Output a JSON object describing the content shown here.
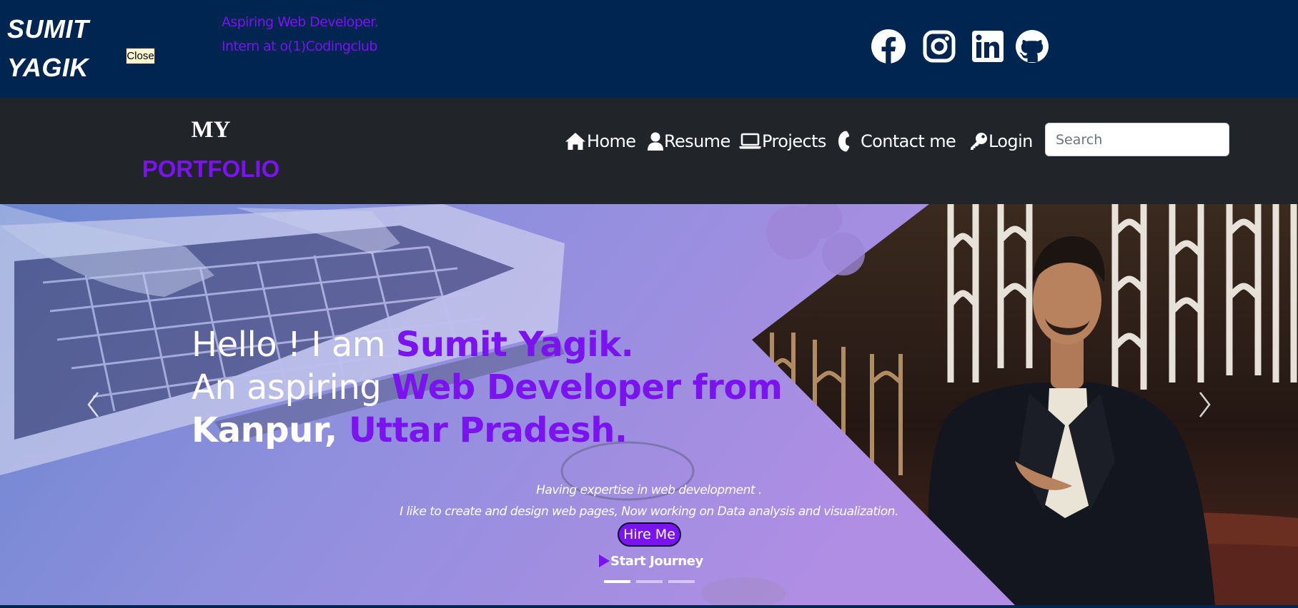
{
  "brand": {
    "line1": "SUMIT",
    "line2": "YAGIK"
  },
  "close_button": "Close",
  "tagline": {
    "line1": "Aspiring Web Developer.",
    "line2": "Intern at o(1)Codingclub"
  },
  "social_icons": [
    "facebook-icon",
    "instagram-icon",
    "linkedin-icon",
    "github-icon"
  ],
  "navbar": {
    "brand_line1": "MY",
    "brand_line2": "PORTFOLIO",
    "links": [
      {
        "label": "Home",
        "icon": "home-icon"
      },
      {
        "label": "Resume",
        "icon": "user-icon"
      },
      {
        "label": "Projects",
        "icon": "laptop-icon"
      },
      {
        "label": "Contact me",
        "icon": "phone-icon"
      },
      {
        "label": "Login",
        "icon": "key-icon"
      }
    ],
    "search_placeholder": "Search"
  },
  "hero": {
    "line1_white": "Hello ! I am ",
    "line1_accent": "Sumit Yagik.",
    "line2_white": "An aspiring ",
    "line2_accent": "Web Developer from",
    "line3_white": "Kanpur, ",
    "line3_accent": "Uttar Pradesh.",
    "desc1": "Having expertise in web development .",
    "desc2": "I like to create and design web pages, Now working on Data analysis and visualization.",
    "hire_button": "Hire Me",
    "journey_link": "Start Journey",
    "slides_count": 3,
    "active_slide": 1
  },
  "colors": {
    "top_bg": "#012551",
    "nav_bg": "#212529",
    "accent": "#7b13f0"
  }
}
